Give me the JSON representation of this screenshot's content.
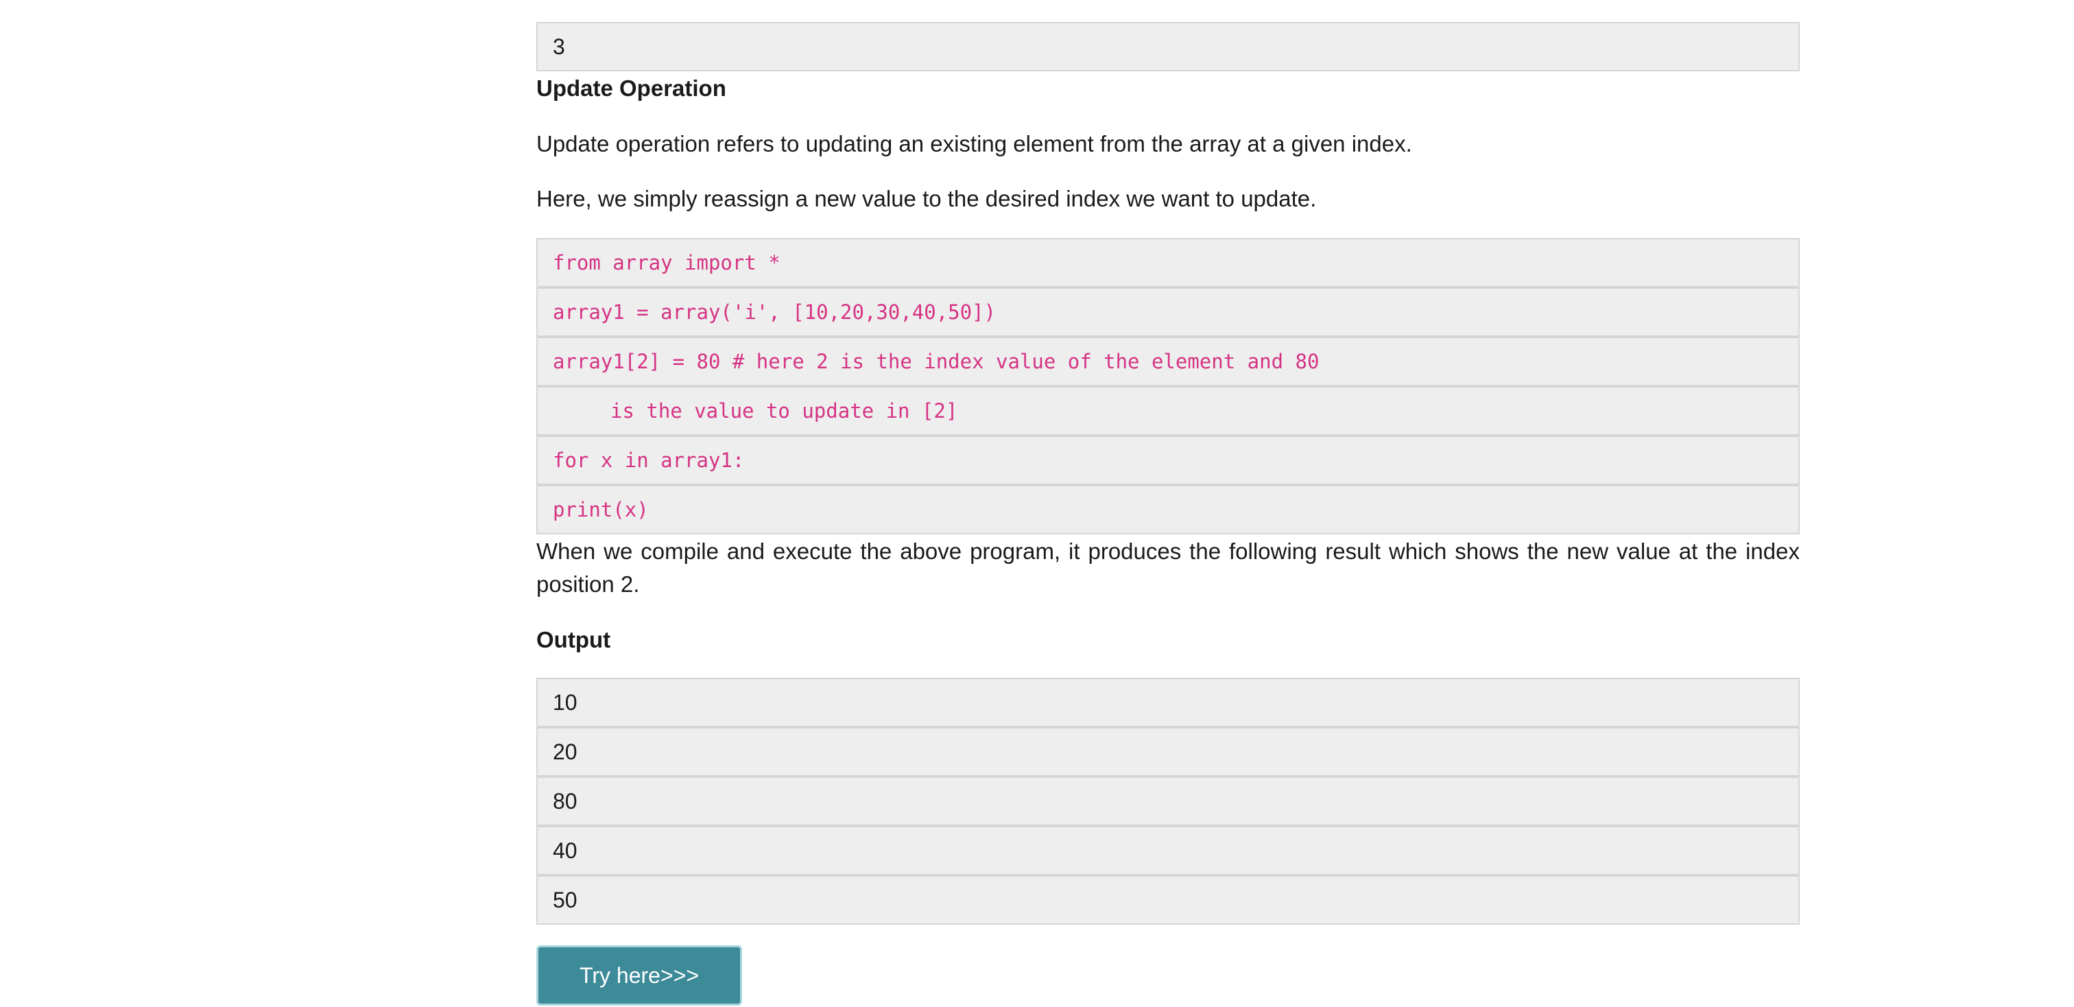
{
  "top_output": {
    "value": "3"
  },
  "update_section": {
    "heading": "Update Operation",
    "para1": "Update operation refers to updating an existing element from the array at a given index.",
    "para2": "Here, we simply reassign a new value to the desired index we want to update."
  },
  "code_block": {
    "lines": [
      "from array import *",
      "array1 = array('i', [10,20,30,40,50])",
      "array1[2] = 80 # here 2 is the index value of the element and 80",
      "is the value to update in [2]",
      "for x in array1:",
      "print(x)"
    ]
  },
  "result_para": "When we compile and execute the above program, it produces the following result which shows the new value at the index position 2.",
  "output_section": {
    "heading": "Output",
    "values": [
      "10",
      "20",
      "80",
      "40",
      "50"
    ]
  },
  "try_button": {
    "label": "Try here>>>"
  }
}
